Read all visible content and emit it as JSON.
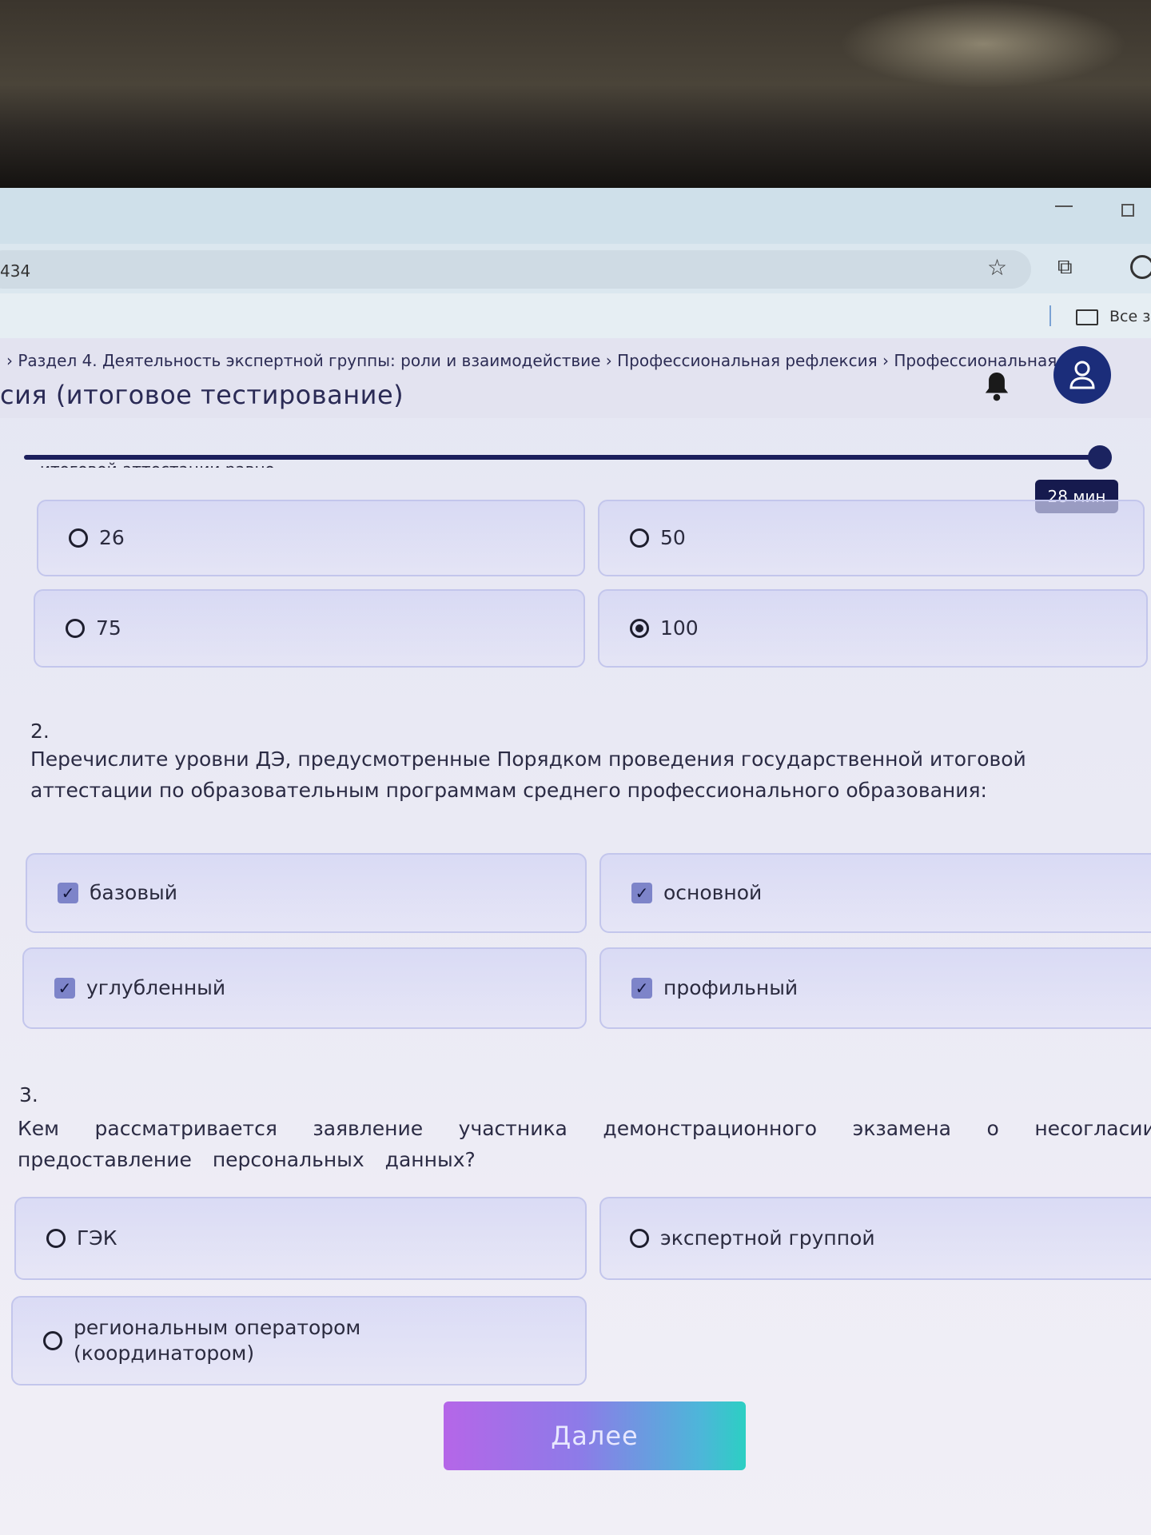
{
  "browser": {
    "url_fragment": "434",
    "bookmarks_label": "Все за"
  },
  "header": {
    "breadcrumb": "› Раздел 4. Деятельность экспертной группы: роли и взаимодействие  ›  Профессиональная рефлексия  ›  Профессиональная ре",
    "title": "сия (итоговое тестирование)"
  },
  "progress": {
    "value_percent": 97,
    "timer": "28 мин",
    "cut_text": "итоговой аттестации равно"
  },
  "questions": [
    {
      "number": "",
      "text": "",
      "options": [
        {
          "label": "26",
          "selected": false
        },
        {
          "label": "50",
          "selected": false
        },
        {
          "label": "75",
          "selected": false
        },
        {
          "label": "100",
          "selected": true
        }
      ]
    },
    {
      "number": "2.",
      "text": "Перечислите уровни ДЭ, предусмотренные Порядком проведения государственной итоговой аттестации по образовательным программам среднего профессионального образования:",
      "options": [
        {
          "label": "базовый",
          "checked": true
        },
        {
          "label": "основной",
          "checked": true
        },
        {
          "label": "углубленный",
          "checked": true
        },
        {
          "label": "профильный",
          "checked": true
        }
      ]
    },
    {
      "number": "3.",
      "text": "Кем рассматривается заявление участника демонстрационного экзамена о несогласии на предоставление персональных данных?",
      "options": [
        {
          "label": "ГЭК",
          "selected": false
        },
        {
          "label": "экспертной группой",
          "selected": false
        },
        {
          "label": "региональным оператором (координатором)",
          "selected": false
        }
      ]
    }
  ],
  "next_button": "Далее",
  "check_glyph": "✓"
}
